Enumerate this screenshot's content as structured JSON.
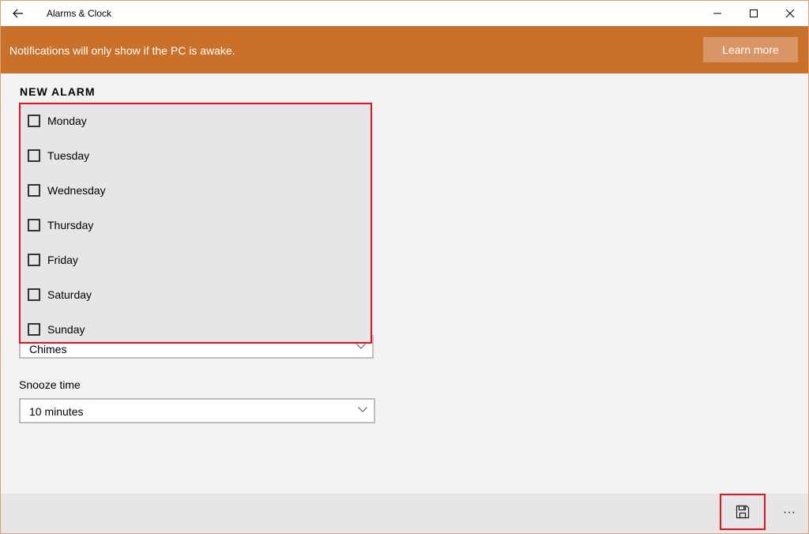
{
  "titlebar": {
    "title": "Alarms & Clock",
    "back_icon": "back-arrow-icon",
    "minimize_icon": "minimize-icon",
    "maximize_icon": "maximize-icon",
    "close_icon": "close-icon"
  },
  "banner": {
    "message": "Notifications will only show if the PC is awake.",
    "learn_more_label": "Learn more",
    "color": "#c9702a"
  },
  "alarm": {
    "section_title": "NEW ALARM",
    "days": [
      {
        "label": "Monday",
        "checked": false
      },
      {
        "label": "Tuesday",
        "checked": false
      },
      {
        "label": "Wednesday",
        "checked": false
      },
      {
        "label": "Thursday",
        "checked": false
      },
      {
        "label": "Friday",
        "checked": false
      },
      {
        "label": "Saturday",
        "checked": false
      },
      {
        "label": "Sunday",
        "checked": false
      }
    ],
    "sound_value": "Chimes",
    "snooze_label": "Snooze time",
    "snooze_value": "10 minutes"
  },
  "commandbar": {
    "save_icon": "save-icon",
    "more_label": "···"
  },
  "colors": {
    "highlight": "#e81123",
    "panel_bg": "#e6e6e6"
  }
}
